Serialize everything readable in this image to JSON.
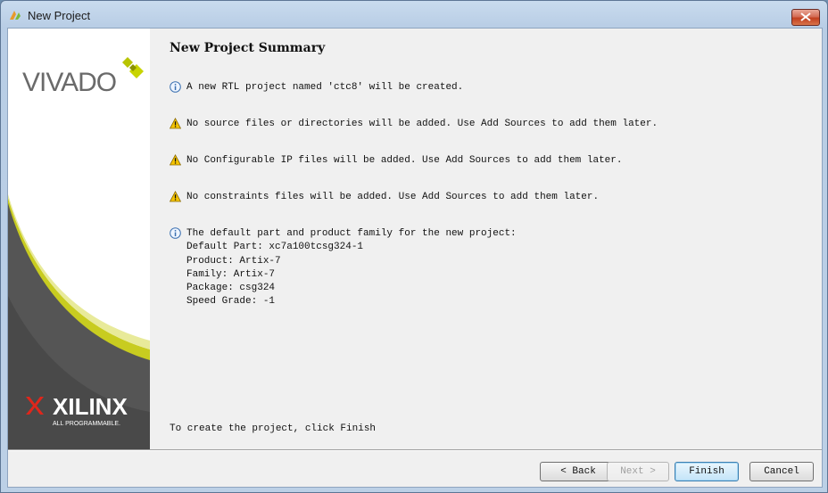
{
  "window": {
    "title": "New Project"
  },
  "branding": {
    "product": "VIVADO",
    "company": "XILINX",
    "tagline": "ALL PROGRAMMABLE."
  },
  "summary": {
    "heading": "New Project Summary",
    "messages": [
      {
        "icon": "info-icon",
        "text": "A new RTL project named 'ctc8' will be created."
      },
      {
        "icon": "warning-icon",
        "text": "No source files or directories will be added. Use Add Sources to add them later."
      },
      {
        "icon": "warning-icon",
        "text": "No Configurable IP files will be added. Use Add Sources to add them later."
      },
      {
        "icon": "warning-icon",
        "text": "No constraints files will be added. Use Add Sources to add them later."
      },
      {
        "icon": "info-icon",
        "text": "The default part and product family for the new project:\nDefault Part: xc7a100tcsg324-1\nProduct: Artix-7\nFamily: Artix-7\nPackage: csg324\nSpeed Grade: -1"
      }
    ],
    "footer": "To create the project, click Finish"
  },
  "buttons": {
    "back": "< Back",
    "next": "Next >",
    "finish": "Finish",
    "cancel": "Cancel"
  },
  "colors": {
    "accent_green": "#c8d400",
    "sidebar_dark": "#4a4a4a",
    "warning_yellow": "#f5c400"
  }
}
